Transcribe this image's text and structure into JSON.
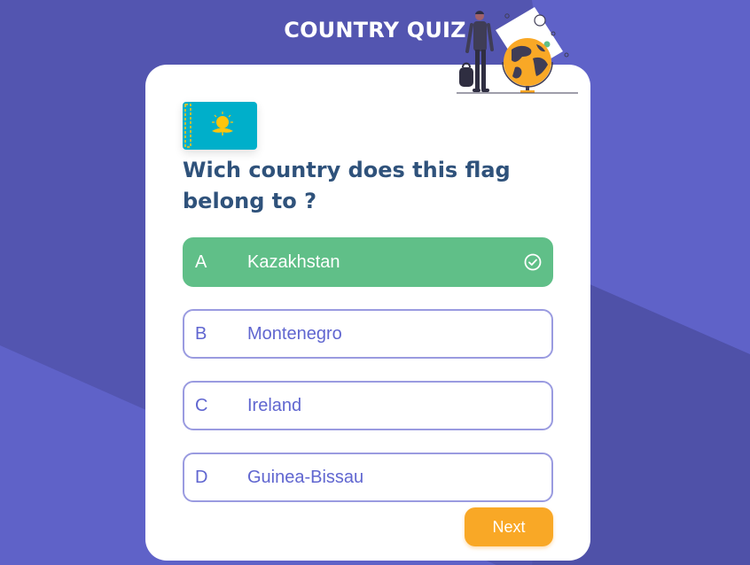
{
  "app": {
    "title": "COUNTRY QUIZ",
    "hero_image_icon": "traveler-with-globe-illustration"
  },
  "colors": {
    "background": "#5a5cc0",
    "card": "#ffffff",
    "correct": "#60bf88",
    "option_border": "#9a9be0",
    "option_text": "#6066d0",
    "question_text": "#2f527b",
    "next_button": "#f9a826"
  },
  "quiz": {
    "flag_icon": "kazakhstan-flag",
    "question": "Wich country does this flag belong to ?",
    "options": [
      {
        "letter": "A",
        "label": "Kazakhstan",
        "state": "correct",
        "icon": "check-circle-icon"
      },
      {
        "letter": "B",
        "label": "Montenegro",
        "state": "default"
      },
      {
        "letter": "C",
        "label": "Ireland",
        "state": "default"
      },
      {
        "letter": "D",
        "label": "Guinea-Bissau",
        "state": "default"
      }
    ],
    "next_label": "Next"
  }
}
